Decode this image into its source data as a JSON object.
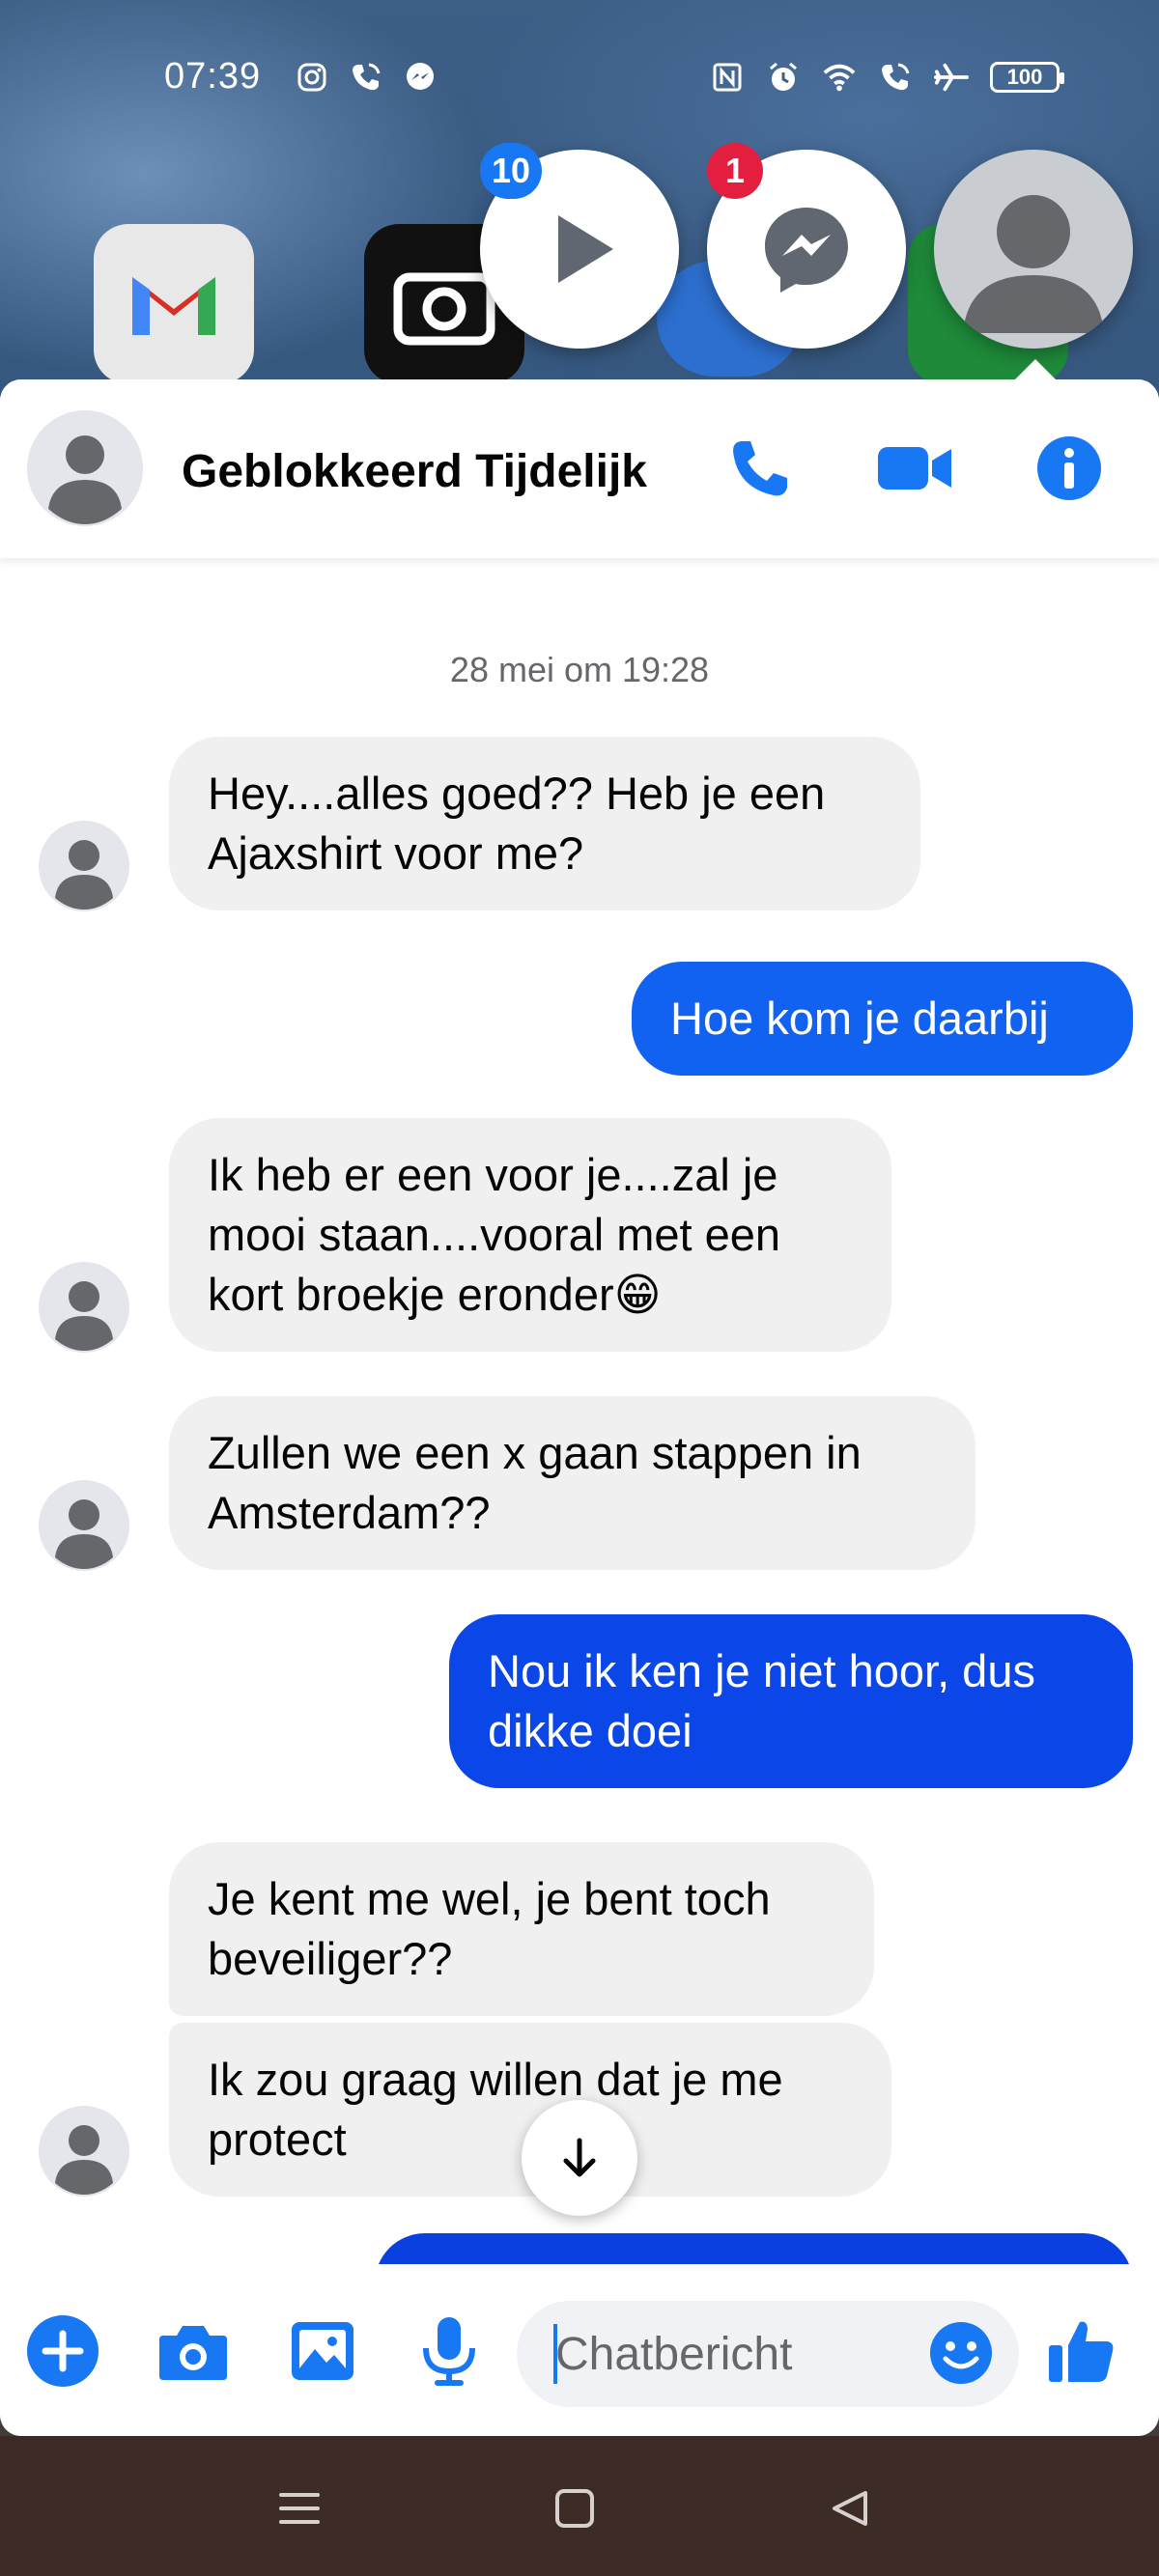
{
  "status_bar": {
    "time": "07:39",
    "battery": "100"
  },
  "chat_heads": {
    "video_badge": "10",
    "messenger_badge": "1"
  },
  "header": {
    "contact_name": "Geblokkeerd Tijdelijk"
  },
  "messages": {
    "timestamp": "28 mei om 19:28",
    "items": [
      {
        "direction": "in",
        "text": "Hey....alles goed?? Heb je een\nAjaxshirt voor me?"
      },
      {
        "direction": "out",
        "text": "Hoe kom je daarbij"
      },
      {
        "direction": "in",
        "text": "Ik heb er een voor je....zal je\nmooi staan....vooral met een\nkort broekje eronder😁"
      },
      {
        "direction": "in",
        "text": "Zullen we een x gaan stappen in\nAmsterdam??"
      },
      {
        "direction": "out",
        "text": "Nou ik ken je niet hoor, dus\ndikke doei"
      },
      {
        "direction": "in",
        "text": "Je kent me wel, je bent toch\nbeveiliger??"
      },
      {
        "direction": "in",
        "text": "Ik zou graag willen dat je me\nprotect"
      }
    ]
  },
  "composer": {
    "placeholder": "Chatbericht"
  },
  "colors": {
    "accent": "#1877f2",
    "outgoing_bubble": "#0a56f0",
    "incoming_bubble": "#f0f0f0"
  },
  "icons": {
    "status_left": [
      "instagram-icon",
      "wifi-call-icon",
      "messenger-icon"
    ],
    "status_right": [
      "nfc-icon",
      "alarm-icon",
      "wifi-icon",
      "wifi-call-icon",
      "airplane-icon",
      "battery-icon"
    ],
    "header": [
      "phone-icon",
      "video-camera-icon",
      "info-icon"
    ],
    "composer": [
      "plus-icon",
      "camera-icon",
      "gallery-icon",
      "microphone-icon",
      "emoji-icon",
      "thumbs-up-icon"
    ],
    "navigation": [
      "menu-icon",
      "home-icon",
      "back-icon"
    ]
  }
}
